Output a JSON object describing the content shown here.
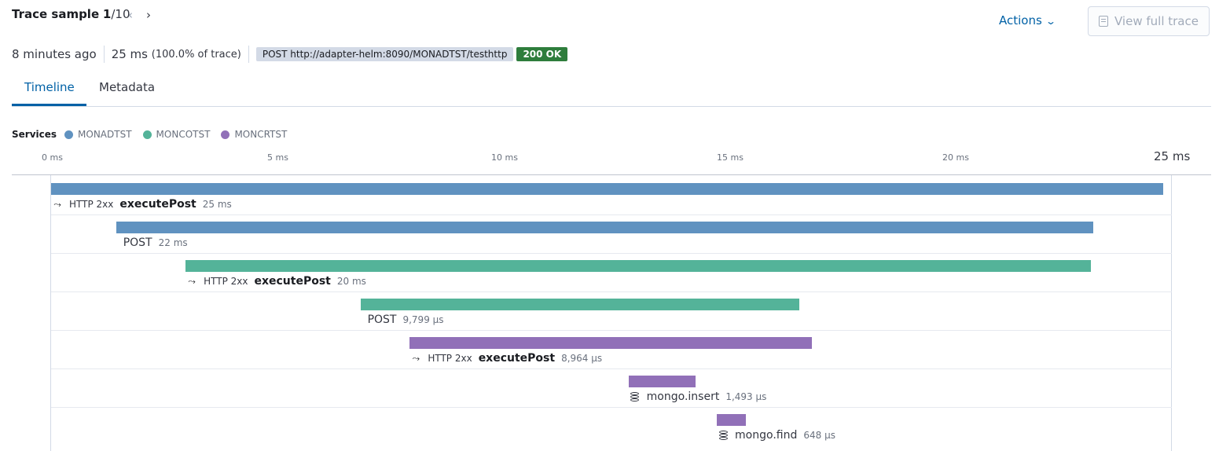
{
  "header": {
    "title_prefix": "Trace sample",
    "sample_current": "1",
    "sample_total": "/10",
    "prev_icon": "‹",
    "next_icon": "›",
    "actions_label": "Actions",
    "view_full_trace_label": "View full trace"
  },
  "summary": {
    "time_ago": "8 minutes ago",
    "duration": "25 ms",
    "duration_pct": "(100.0% of trace)",
    "request": "POST http://adapter-helm:8090/MONADTST/testhttp",
    "status": "200 OK"
  },
  "tabs": [
    {
      "label": "Timeline",
      "active": true
    },
    {
      "label": "Metadata",
      "active": false
    }
  ],
  "legend": {
    "label": "Services",
    "services": [
      {
        "name": "MONADTST",
        "color": "#6092c0"
      },
      {
        "name": "MONCOTST",
        "color": "#54b399"
      },
      {
        "name": "MONCRTST",
        "color": "#9170b8"
      }
    ]
  },
  "timeline": {
    "unit": "ms",
    "max_ms": 25,
    "ticks": [
      "0 ms",
      "5 ms",
      "10 ms",
      "15 ms",
      "20 ms"
    ],
    "end_label": "25 ms"
  },
  "spans": [
    {
      "icon": "http-exit-icon",
      "hint": "HTTP 2xx",
      "name": "executePost",
      "bold": true,
      "duration": "25 ms",
      "start_ms": 0,
      "duration_ms": 24.8,
      "service": "MONADTST",
      "color": "#6092c0"
    },
    {
      "icon": "",
      "hint": "",
      "name": "POST",
      "bold": false,
      "duration": "22 ms",
      "start_ms": 1.45,
      "duration_ms": 21.8,
      "service": "MONADTST",
      "color": "#6092c0"
    },
    {
      "icon": "http-exit-icon",
      "hint": "HTTP 2xx",
      "name": "executePost",
      "bold": true,
      "duration": "20 ms",
      "start_ms": 3.0,
      "duration_ms": 20.2,
      "service": "MONCOTST",
      "color": "#54b399"
    },
    {
      "icon": "",
      "hint": "",
      "name": "POST",
      "bold": false,
      "duration": "9,799 μs",
      "start_ms": 6.9,
      "duration_ms": 9.799,
      "service": "MONCOTST",
      "color": "#54b399"
    },
    {
      "icon": "http-exit-icon",
      "hint": "HTTP 2xx",
      "name": "executePost",
      "bold": true,
      "duration": "8,964 μs",
      "start_ms": 8.0,
      "duration_ms": 8.964,
      "service": "MONCRTST",
      "color": "#9170b8"
    },
    {
      "icon": "database-icon",
      "hint": "",
      "name": "mongo.insert",
      "bold": false,
      "duration": "1,493 μs",
      "start_ms": 12.88,
      "duration_ms": 1.493,
      "service": "MONCRTST",
      "color": "#9170b8"
    },
    {
      "icon": "database-icon",
      "hint": "",
      "name": "mongo.find",
      "bold": false,
      "duration": "648 μs",
      "start_ms": 14.85,
      "duration_ms": 0.648,
      "service": "MONCRTST",
      "color": "#9170b8"
    }
  ]
}
